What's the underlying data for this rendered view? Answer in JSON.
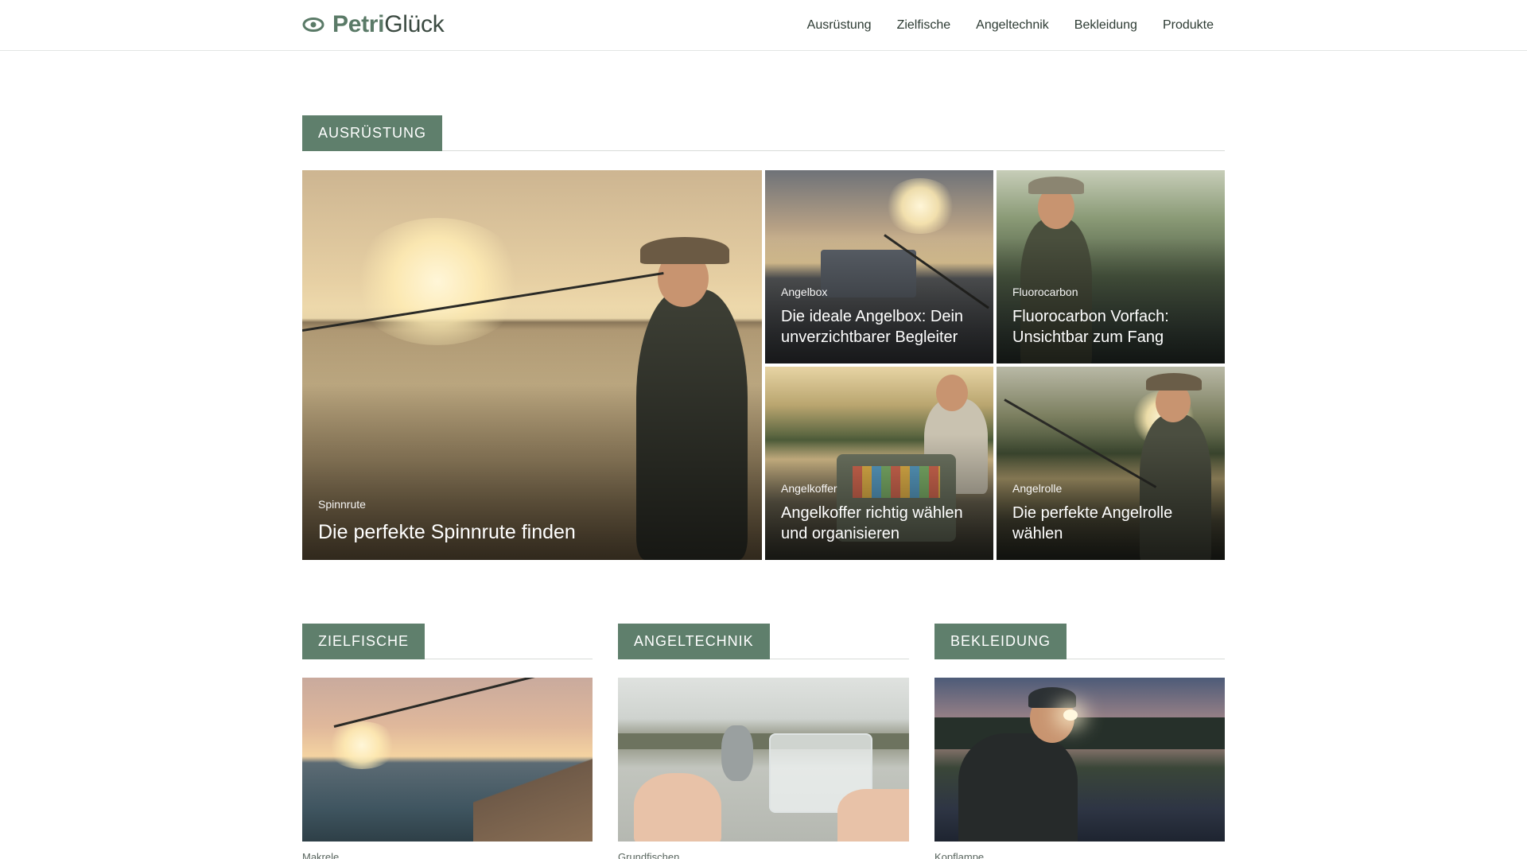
{
  "header": {
    "logo": {
      "part1": "Petri",
      "part2": "Glück"
    },
    "nav": [
      "Ausrüstung",
      "Zielfische",
      "Angeltechnik",
      "Bekleidung",
      "Produkte"
    ]
  },
  "sections": {
    "ausruestung": {
      "label": "AUSRÜSTUNG",
      "featured": {
        "tag": "Spinnrute",
        "title": "Die perfekte Spinnrute finden"
      },
      "cards": [
        {
          "tag": "Angelbox",
          "title": "Die ideale Angelbox: Dein unverzichtbarer Begleiter"
        },
        {
          "tag": "Fluorocarbon",
          "title": "Fluorocarbon Vorfach: Unsichtbar zum Fang"
        },
        {
          "tag": "Angelkoffer",
          "title": "Angelkoffer richtig wählen und organisieren"
        },
        {
          "tag": "Angelrolle",
          "title": "Die perfekte Angelrolle wählen"
        }
      ]
    },
    "zielfische": {
      "label": "ZIELFISCHE",
      "card_tag": "Makrele"
    },
    "angeltechnik": {
      "label": "ANGELTECHNIK",
      "card_tag": "Grundfischen"
    },
    "bekleidung": {
      "label": "BEKLEIDUNG",
      "card_tag": "Kopflampe"
    }
  },
  "colors": {
    "accent": "#5f7f6c",
    "text": "#2d3b33",
    "divider": "#d8dcd9"
  }
}
